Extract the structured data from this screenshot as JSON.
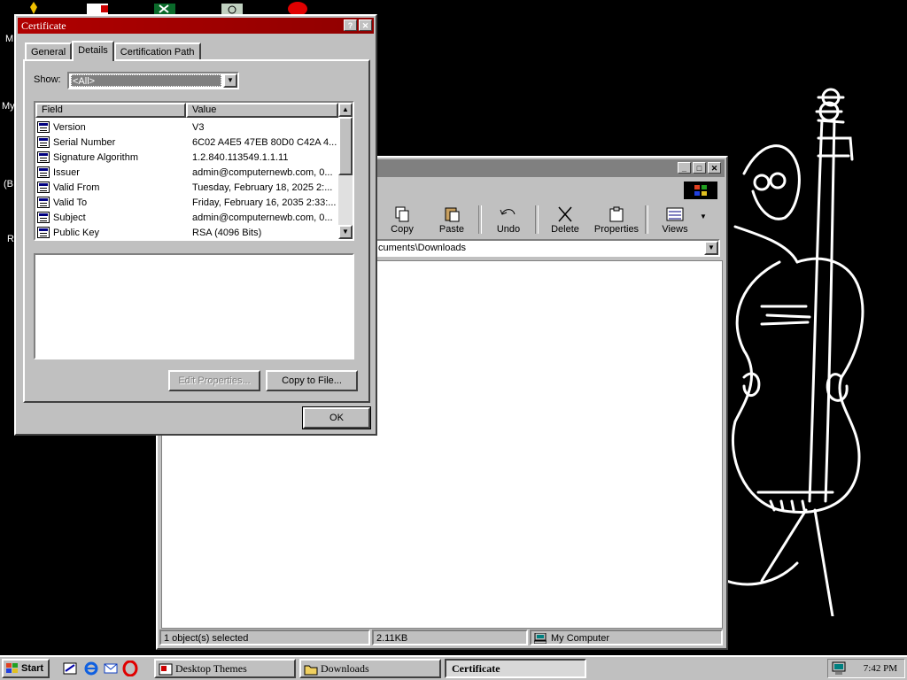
{
  "desktop": {
    "labels": [
      "M",
      "My",
      "(B",
      "R"
    ]
  },
  "explorer": {
    "toolbar": [
      {
        "label": "Copy",
        "icon": "copy-icon"
      },
      {
        "label": "Paste",
        "icon": "paste-icon"
      },
      {
        "label": "Undo",
        "icon": "undo-icon"
      },
      {
        "label": "Delete",
        "icon": "delete-icon"
      },
      {
        "label": "Properties",
        "icon": "properties-icon"
      },
      {
        "label": "Views",
        "icon": "views-icon"
      }
    ],
    "address": "cuments\\Downloads",
    "status": {
      "selected": "1 object(s) selected",
      "size": "2.11KB",
      "zone": "My Computer"
    }
  },
  "certificate": {
    "title": "Certificate",
    "tabs": [
      "General",
      "Details",
      "Certification Path"
    ],
    "active_tab": "Details",
    "show_label": "Show:",
    "show_value": "<All>",
    "columns": {
      "field": "Field",
      "value": "Value"
    },
    "rows": [
      {
        "field": "Version",
        "value": "V3"
      },
      {
        "field": "Serial Number",
        "value": "6C02 A4E5 47EB 80D0 C42A 4..."
      },
      {
        "field": "Signature Algorithm",
        "value": "1.2.840.113549.1.1.11"
      },
      {
        "field": "Issuer",
        "value": "admin@computernewb.com, 0..."
      },
      {
        "field": "Valid From",
        "value": "Tuesday, February 18, 2025 2:..."
      },
      {
        "field": "Valid To",
        "value": "Friday, February 16, 2035 2:33:..."
      },
      {
        "field": "Subject",
        "value": "admin@computernewb.com, 0..."
      },
      {
        "field": "Public Key",
        "value": "RSA (4096 Bits)"
      }
    ],
    "edit_properties": "Edit Properties...",
    "copy_to_file": "Copy to File...",
    "ok": "OK"
  },
  "taskbar": {
    "start": "Start",
    "tasks": [
      "Desktop Themes",
      "Downloads",
      "Certificate"
    ],
    "active_task": "Certificate",
    "clock": "7:42 PM"
  },
  "colors": {
    "desktop": "#000000",
    "face": "#c0c0c0",
    "title_active": "#a00000",
    "title_inactive": "#808080"
  }
}
